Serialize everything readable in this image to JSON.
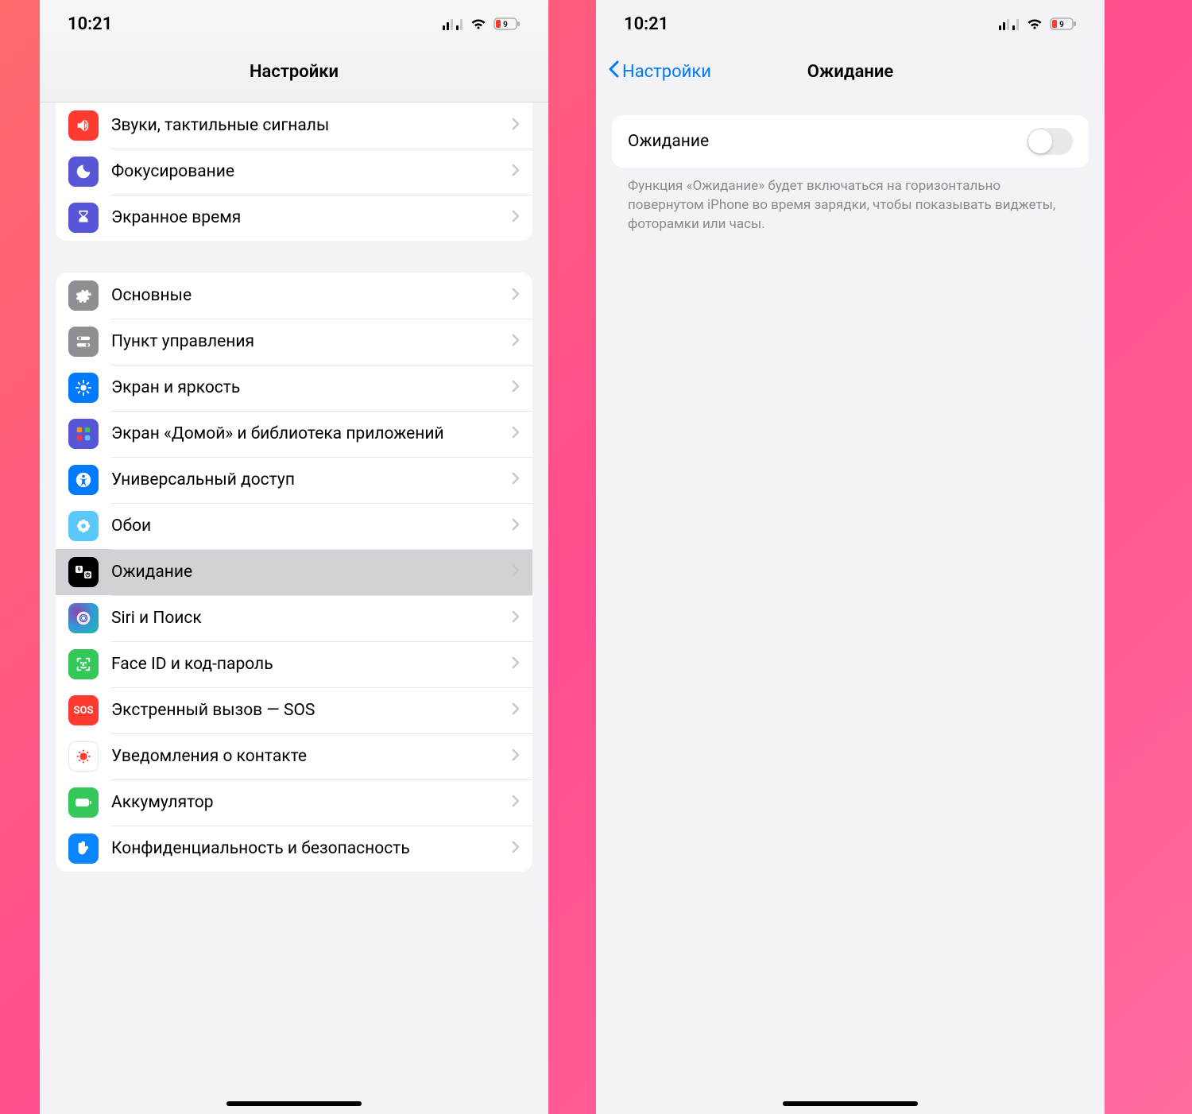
{
  "status": {
    "time": "10:21",
    "battery_pct": "9"
  },
  "phone1": {
    "title": "Настройки",
    "group1": [
      {
        "label": "Звуки, тактильные сигналы",
        "icon": "speaker-icon",
        "color": "ic-red"
      },
      {
        "label": "Фокусирование",
        "icon": "moon-icon",
        "color": "ic-purple"
      },
      {
        "label": "Экранное время",
        "icon": "hourglass-icon",
        "color": "ic-purple"
      }
    ],
    "group2": [
      {
        "label": "Основные",
        "icon": "gear-icon",
        "color": "ic-gray"
      },
      {
        "label": "Пункт управления",
        "icon": "switches-icon",
        "color": "ic-gray"
      },
      {
        "label": "Экран и яркость",
        "icon": "brightness-icon",
        "color": "ic-blue"
      },
      {
        "label": "Экран «Домой» и библиотека приложений",
        "icon": "home-grid-icon",
        "color": "ic-home"
      },
      {
        "label": "Универсальный доступ",
        "icon": "accessibility-icon",
        "color": "ic-blue"
      },
      {
        "label": "Обои",
        "icon": "flower-icon",
        "color": "ic-cyan"
      },
      {
        "label": "Ожидание",
        "icon": "standby-icon",
        "color": "ic-black",
        "selected": true
      },
      {
        "label": "Siri и Поиск",
        "icon": "siri-icon",
        "color": "ic-siri"
      },
      {
        "label": "Face ID и код-пароль",
        "icon": "faceid-icon",
        "color": "ic-green"
      },
      {
        "label": "Экстренный вызов — SOS",
        "icon": "sos-icon",
        "color": "ic-red"
      },
      {
        "label": "Уведомления о контакте",
        "icon": "exposure-icon",
        "color": "ic-white"
      },
      {
        "label": "Аккумулятор",
        "icon": "battery-icon",
        "color": "ic-green"
      },
      {
        "label": "Конфиденциальность и безопасность",
        "icon": "hand-icon",
        "color": "ic-blue2"
      }
    ]
  },
  "phone2": {
    "back_label": "Настройки",
    "title": "Ожидание",
    "toggle": {
      "label": "Ожидание",
      "on": false
    },
    "footer": "Функция «Ожидание» будет включаться на горизонтально повернутом iPhone во время зарядки, чтобы показывать виджеты, фоторамки или часы."
  }
}
